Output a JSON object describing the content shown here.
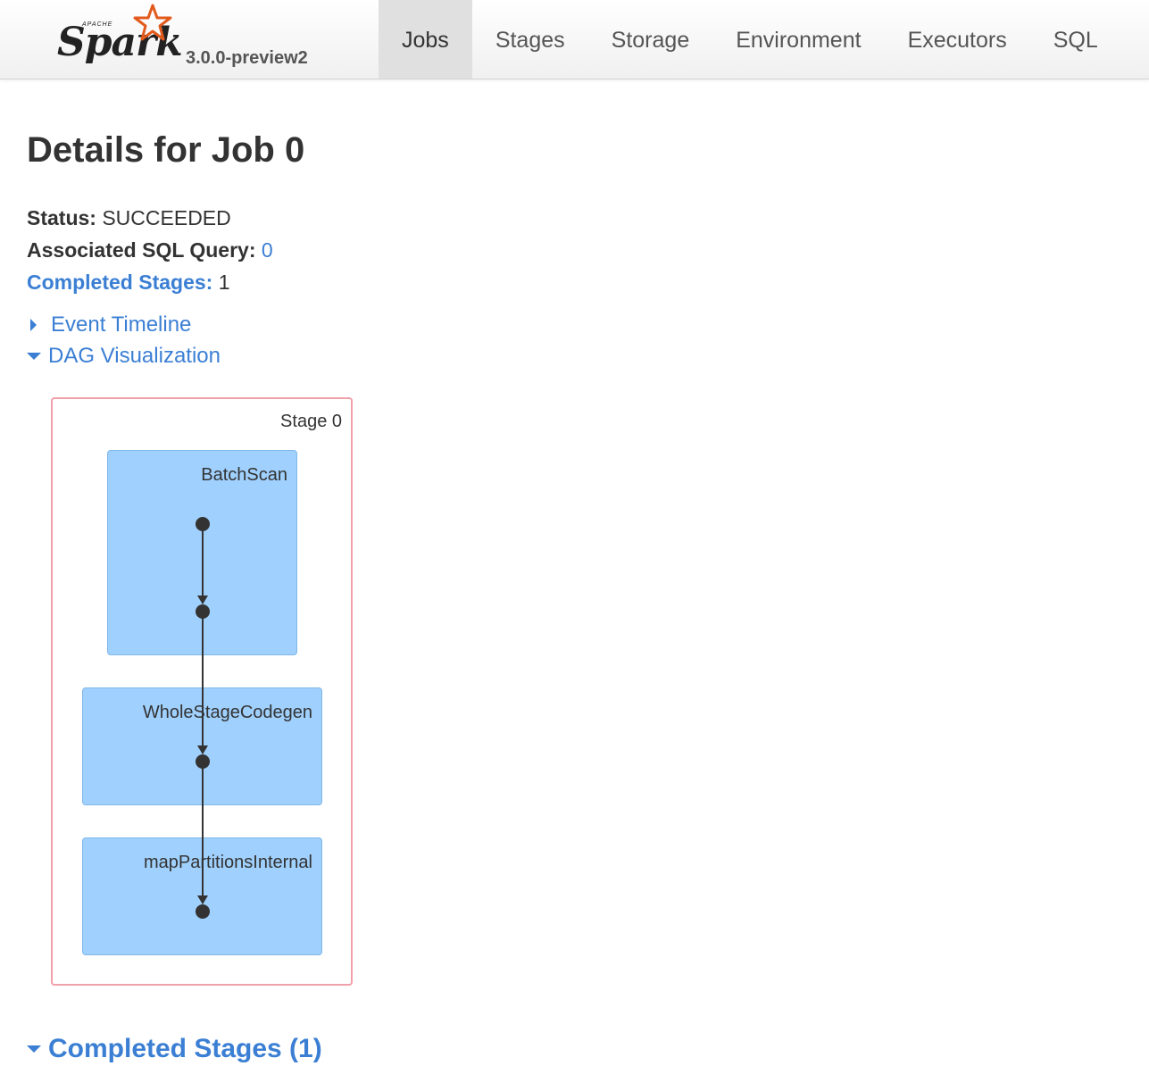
{
  "navbar": {
    "brand_small": "APACHE",
    "brand_name": "Spark",
    "version": "3.0.0-preview2",
    "tabs": [
      {
        "label": "Jobs",
        "active": true
      },
      {
        "label": "Stages",
        "active": false
      },
      {
        "label": "Storage",
        "active": false
      },
      {
        "label": "Environment",
        "active": false
      },
      {
        "label": "Executors",
        "active": false
      },
      {
        "label": "SQL",
        "active": false
      }
    ]
  },
  "page": {
    "title": "Details for Job 0",
    "status_label": "Status:",
    "status_value": "SUCCEEDED",
    "sql_query_label": "Associated SQL Query:",
    "sql_query_value": "0",
    "completed_stages_label": "Completed Stages:",
    "completed_stages_value": "1"
  },
  "toggles": {
    "event_timeline": "Event Timeline",
    "dag_visualization": "DAG Visualization"
  },
  "dag": {
    "stage_label": "Stage 0",
    "clusters": [
      "BatchScan",
      "WholeStageCodegen",
      "mapPartitionsInternal"
    ]
  },
  "completed_stages_section": {
    "title": "Completed Stages (1)"
  },
  "colors": {
    "link": "#3b7fd4",
    "stage_border": "#f0a0aa",
    "cluster_fill": "#a0d0fd",
    "node": "#333333"
  }
}
